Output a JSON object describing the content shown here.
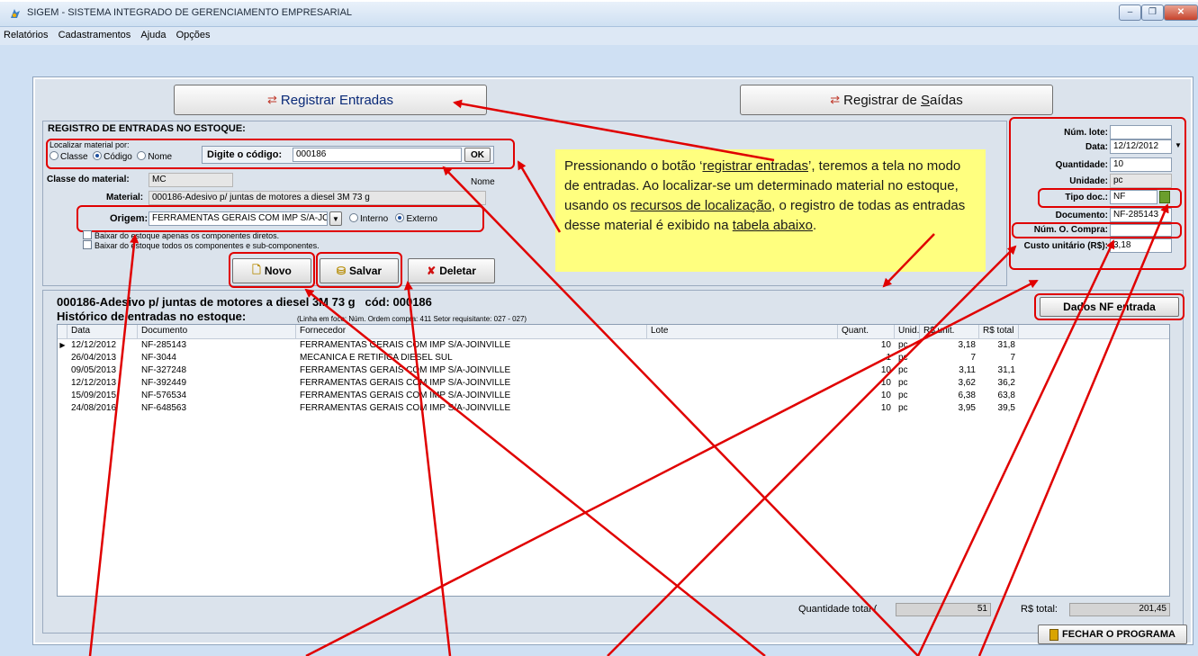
{
  "window": {
    "title": "SIGEM - SISTEMA INTEGRADO DE GERENCIAMENTO EMPRESARIAL",
    "controls": [
      "–",
      "❐",
      "✕"
    ]
  },
  "menu": [
    "Relatórios",
    "Cadastramentos",
    "Ajuda",
    "Opções"
  ],
  "top_buttons": {
    "entries": "Registrar Entradas",
    "exits_pre": "Registrar de ",
    "exits_under": "S",
    "exits_post": "aídas"
  },
  "entry": {
    "section_title": "REGISTRO DE ENTRADAS NO ESTOQUE:",
    "locate_label": "Localizar material por:",
    "radios": [
      "Classe",
      "Código",
      "Nome"
    ],
    "radio_selected": "Código",
    "code_label": "Digite o código:",
    "code_value": "000186",
    "ok": "OK",
    "name_hint": "Nome",
    "class_label": "Classe do material:",
    "class_value": "MC",
    "material_label": "Material:",
    "material_value": "000186-Adesivo p/ juntas de motores a diesel 3M 73 g",
    "origin_label": "Origem:",
    "origin_value": "FERRAMENTAS GERAIS COM IMP S/A-JOINV",
    "origin_internal": "Interno",
    "origin_external": "Externo",
    "origin_selected": "Externo",
    "check1": "Baixar do estoque apenas os componentes diretos.",
    "check2": "Baixar do estoque todos os componentes e sub-componentes.",
    "btn_new": "Novo",
    "btn_save": "Salvar",
    "btn_delete": "Deletar"
  },
  "side": {
    "lot_label": "Núm. lote:",
    "lot_value": "",
    "date_label": "Data:",
    "date_value": "12/12/2012",
    "qty_label": "Quantidade:",
    "qty_value": "10",
    "unit_label": "Unidade:",
    "unit_value": "pc",
    "doctype_label": "Tipo doc.:",
    "doctype_value": "NF",
    "doc_label": "Documento:",
    "doc_value": "NF-285143",
    "po_label": "Núm. O. Compra:",
    "po_value": "",
    "cost_label": "Custo unitário (R$):",
    "cost_value": "3,18"
  },
  "note": {
    "p1": "Pressionando o botão ‘",
    "u1": "registrar entradas",
    "p2": "’, teremos a tela no modo de entradas. Ao localizar-se um determinado material no estoque, usando os ",
    "u2": "recursos de localização",
    "p3": ", o registro de todas as entradas desse material é exibido na ",
    "u3": "tabela abaixo",
    "p4": "."
  },
  "history": {
    "material_line": "000186-Adesivo p/ juntas de motores a diesel 3M 73 g   cód: 000186",
    "title": "Histórico de entradas no estoque:",
    "focus_line": "(Linha em foco: Núm. Ordem compra: 411   Setor requisitante: 027 - 027)",
    "nf_button": "Dados NF entrada",
    "columns": [
      "Data",
      "Documento",
      "Fornecedor",
      "Lote",
      "Quant.",
      "Unid.",
      "R$ unit.",
      "R$ total"
    ],
    "rows": [
      [
        "12/12/2012",
        "NF-285143",
        "FERRAMENTAS GERAIS COM IMP S/A-JOINVILLE",
        "",
        "10",
        "pc",
        "3,18",
        "31,8"
      ],
      [
        "26/04/2013",
        "NF-3044",
        "MECANICA E RETIFICA DIESEL SUL",
        "",
        "1",
        "pc",
        "7",
        "7"
      ],
      [
        "09/05/2013",
        "NF-327248",
        "FERRAMENTAS GERAIS COM IMP S/A-JOINVILLE",
        "",
        "10",
        "pc",
        "3,11",
        "31,1"
      ],
      [
        "12/12/2013",
        "NF-392449",
        "FERRAMENTAS GERAIS COM IMP S/A-JOINVILLE",
        "",
        "10",
        "pc",
        "3,62",
        "36,2"
      ],
      [
        "15/09/2015",
        "NF-576534",
        "FERRAMENTAS GERAIS COM IMP S/A-JOINVILLE",
        "",
        "10",
        "pc",
        "6,38",
        "63,8"
      ],
      [
        "24/08/2016",
        "NF-648563",
        "FERRAMENTAS GERAIS COM IMP S/A-JOINVILLE",
        "",
        "10",
        "pc",
        "3,95",
        "39,5"
      ]
    ],
    "total_qty_label": "Quantidade total (",
    "total_qty_value": "51",
    "total_value_label": "R$ total:",
    "total_value": "201,45",
    "close_button": "FECHAR O PROGRAMA"
  },
  "colors": {
    "annotation": "#e00000",
    "note_bg": "#ffff7f",
    "button_text": "#0a2a78"
  }
}
